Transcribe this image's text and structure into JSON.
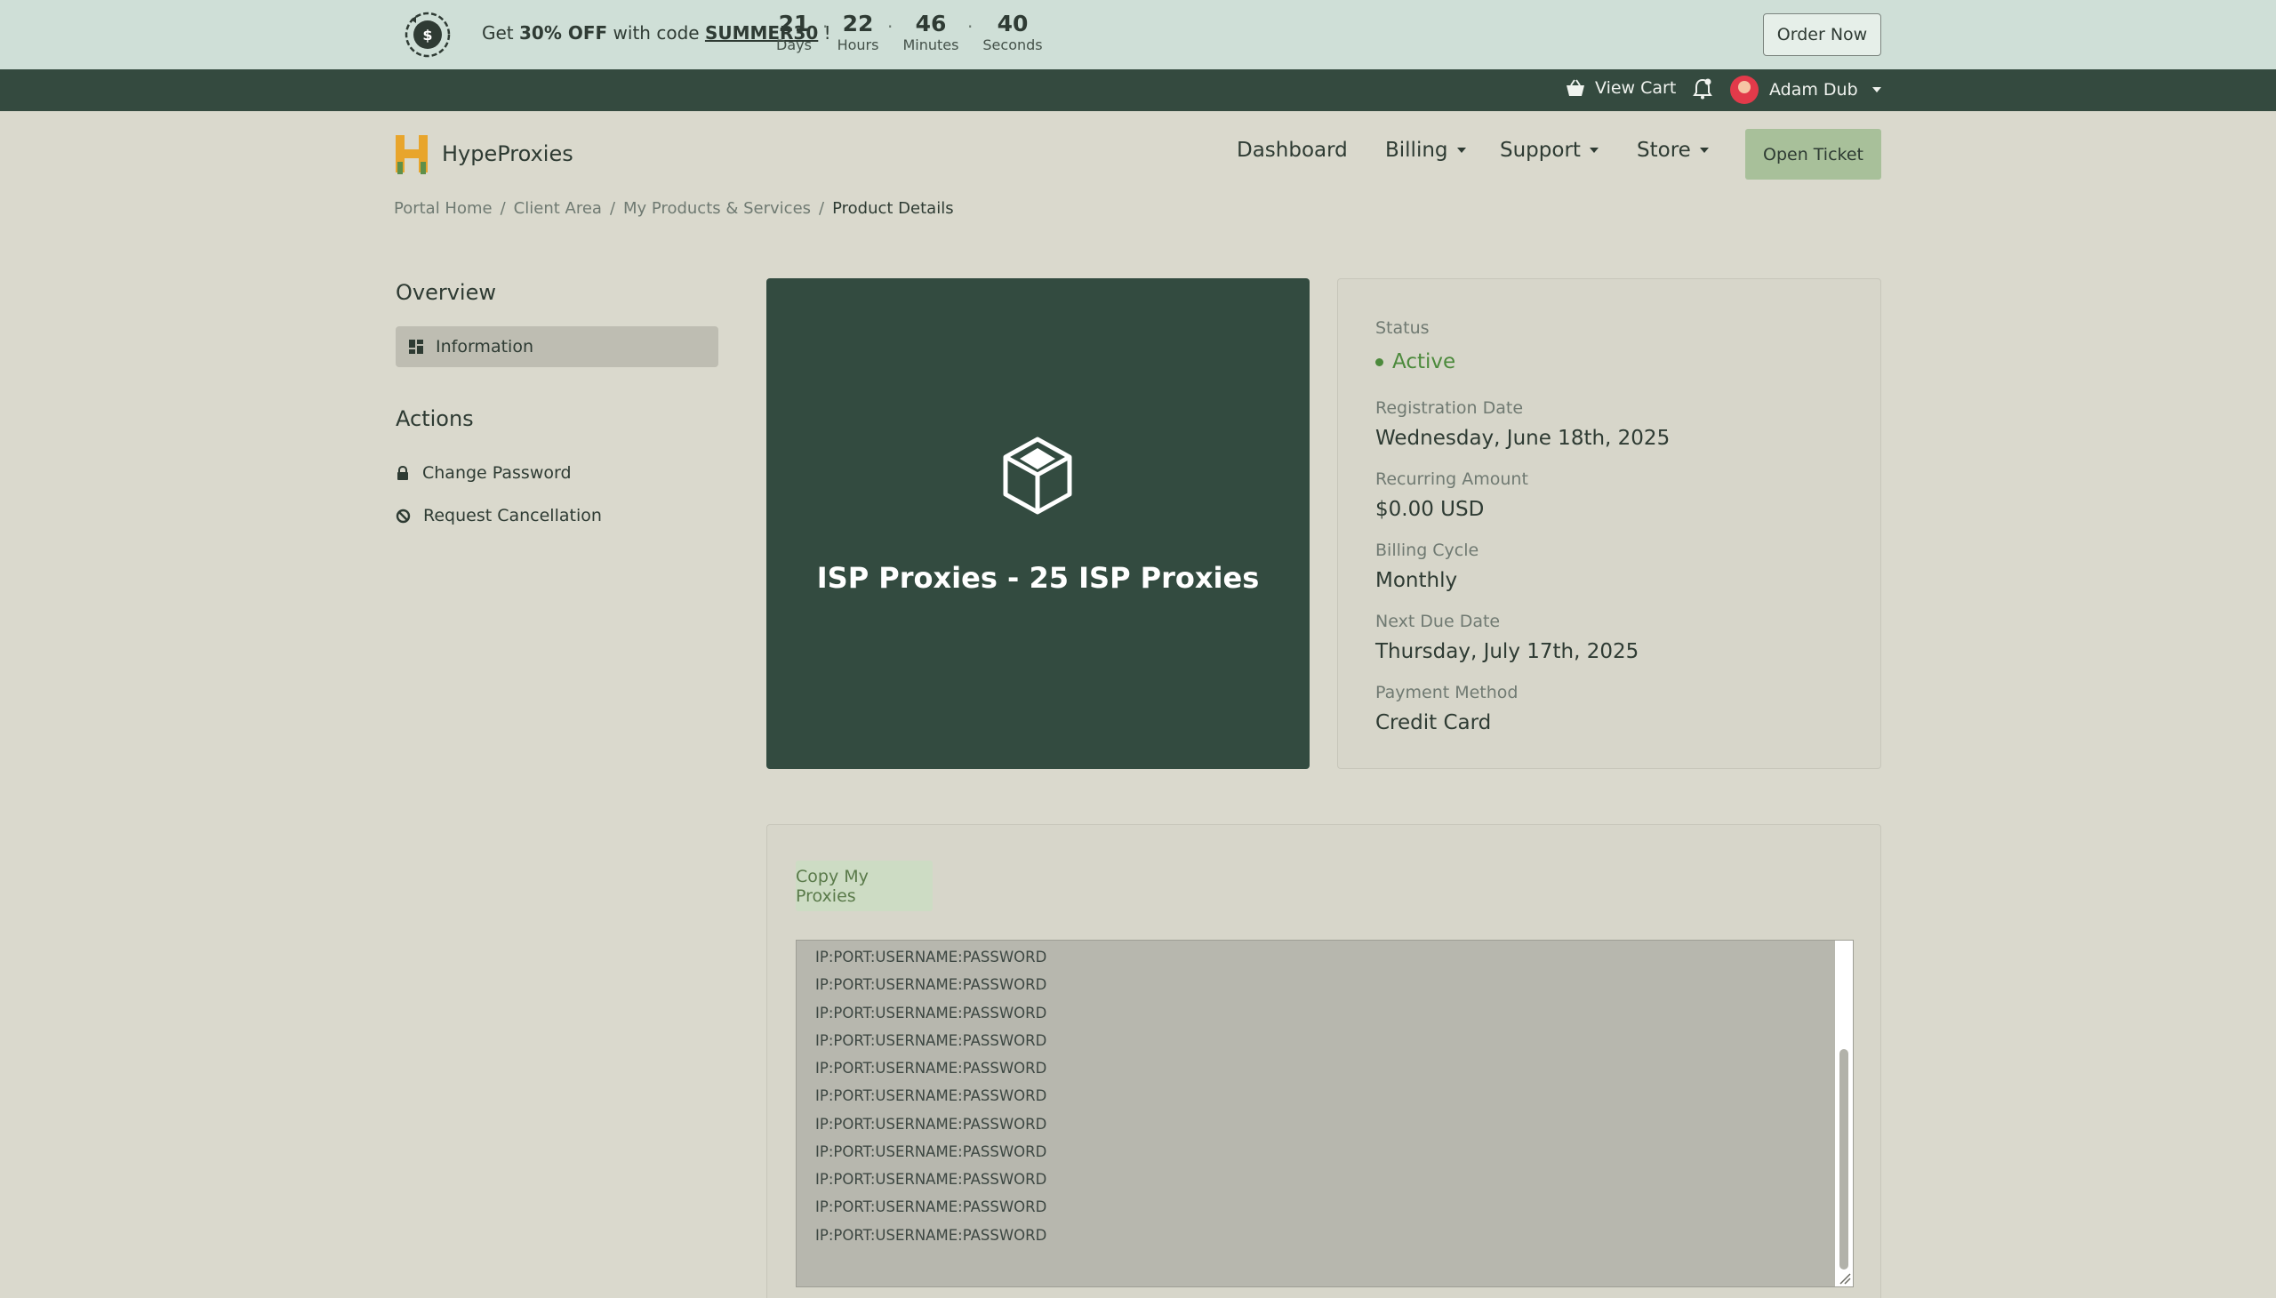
{
  "promo": {
    "prefix": "Get ",
    "discount": "30% OFF",
    "middle": " with code ",
    "code": "SUMMER30",
    "suffix": " !",
    "countdown": [
      {
        "value": "21",
        "label": "Days"
      },
      {
        "value": "22",
        "label": "Hours"
      },
      {
        "value": "46",
        "label": "Minutes"
      },
      {
        "value": "40",
        "label": "Seconds"
      }
    ],
    "order_button": "Order Now"
  },
  "topbar": {
    "cart_label": "View Cart",
    "user_name": "Adam Dub"
  },
  "header": {
    "brand": "HypeProxies",
    "nav": [
      {
        "label": "Dashboard",
        "has_menu": false
      },
      {
        "label": "Billing",
        "has_menu": true
      },
      {
        "label": "Support",
        "has_menu": true
      },
      {
        "label": "Store",
        "has_menu": true
      }
    ],
    "open_ticket": "Open Ticket"
  },
  "breadcrumb": {
    "items": [
      "Portal Home",
      "Client Area",
      "My Products & Services"
    ],
    "current": "Product Details",
    "separator": "/"
  },
  "sidebar": {
    "overview_heading": "Overview",
    "information_label": "Information",
    "actions_heading": "Actions",
    "actions": [
      {
        "label": "Change Password",
        "icon": "lock-icon"
      },
      {
        "label": "Request Cancellation",
        "icon": "ban-icon"
      }
    ]
  },
  "product": {
    "title": "ISP Proxies - 25 ISP Proxies",
    "icon": "cube-icon"
  },
  "details": {
    "status_label": "Status",
    "status_value": "Active",
    "registration_label": "Registration Date",
    "registration_value": "Wednesday, June 18th, 2025",
    "recurring_label": "Recurring Amount",
    "recurring_value": "$0.00 USD",
    "cycle_label": "Billing Cycle",
    "cycle_value": "Monthly",
    "due_label": "Next Due Date",
    "due_value": "Thursday, July 17th, 2025",
    "payment_label": "Payment Method",
    "payment_value": "Credit Card"
  },
  "proxies": {
    "copy_button": "Copy My Proxies",
    "lines": [
      "IP:PORT:USERNAME:PASSWORD",
      "IP:PORT:USERNAME:PASSWORD",
      "IP:PORT:USERNAME:PASSWORD",
      "IP:PORT:USERNAME:PASSWORD",
      "IP:PORT:USERNAME:PASSWORD",
      "IP:PORT:USERNAME:PASSWORD",
      "IP:PORT:USERNAME:PASSWORD",
      "IP:PORT:USERNAME:PASSWORD",
      "IP:PORT:USERNAME:PASSWORD",
      "IP:PORT:USERNAME:PASSWORD",
      "IP:PORT:USERNAME:PASSWORD"
    ]
  },
  "colors": {
    "accent_green": "#a8c09a",
    "dark_green": "#344a3f",
    "status_active": "#4c8a3c",
    "page_bg": "#dad9cd"
  }
}
